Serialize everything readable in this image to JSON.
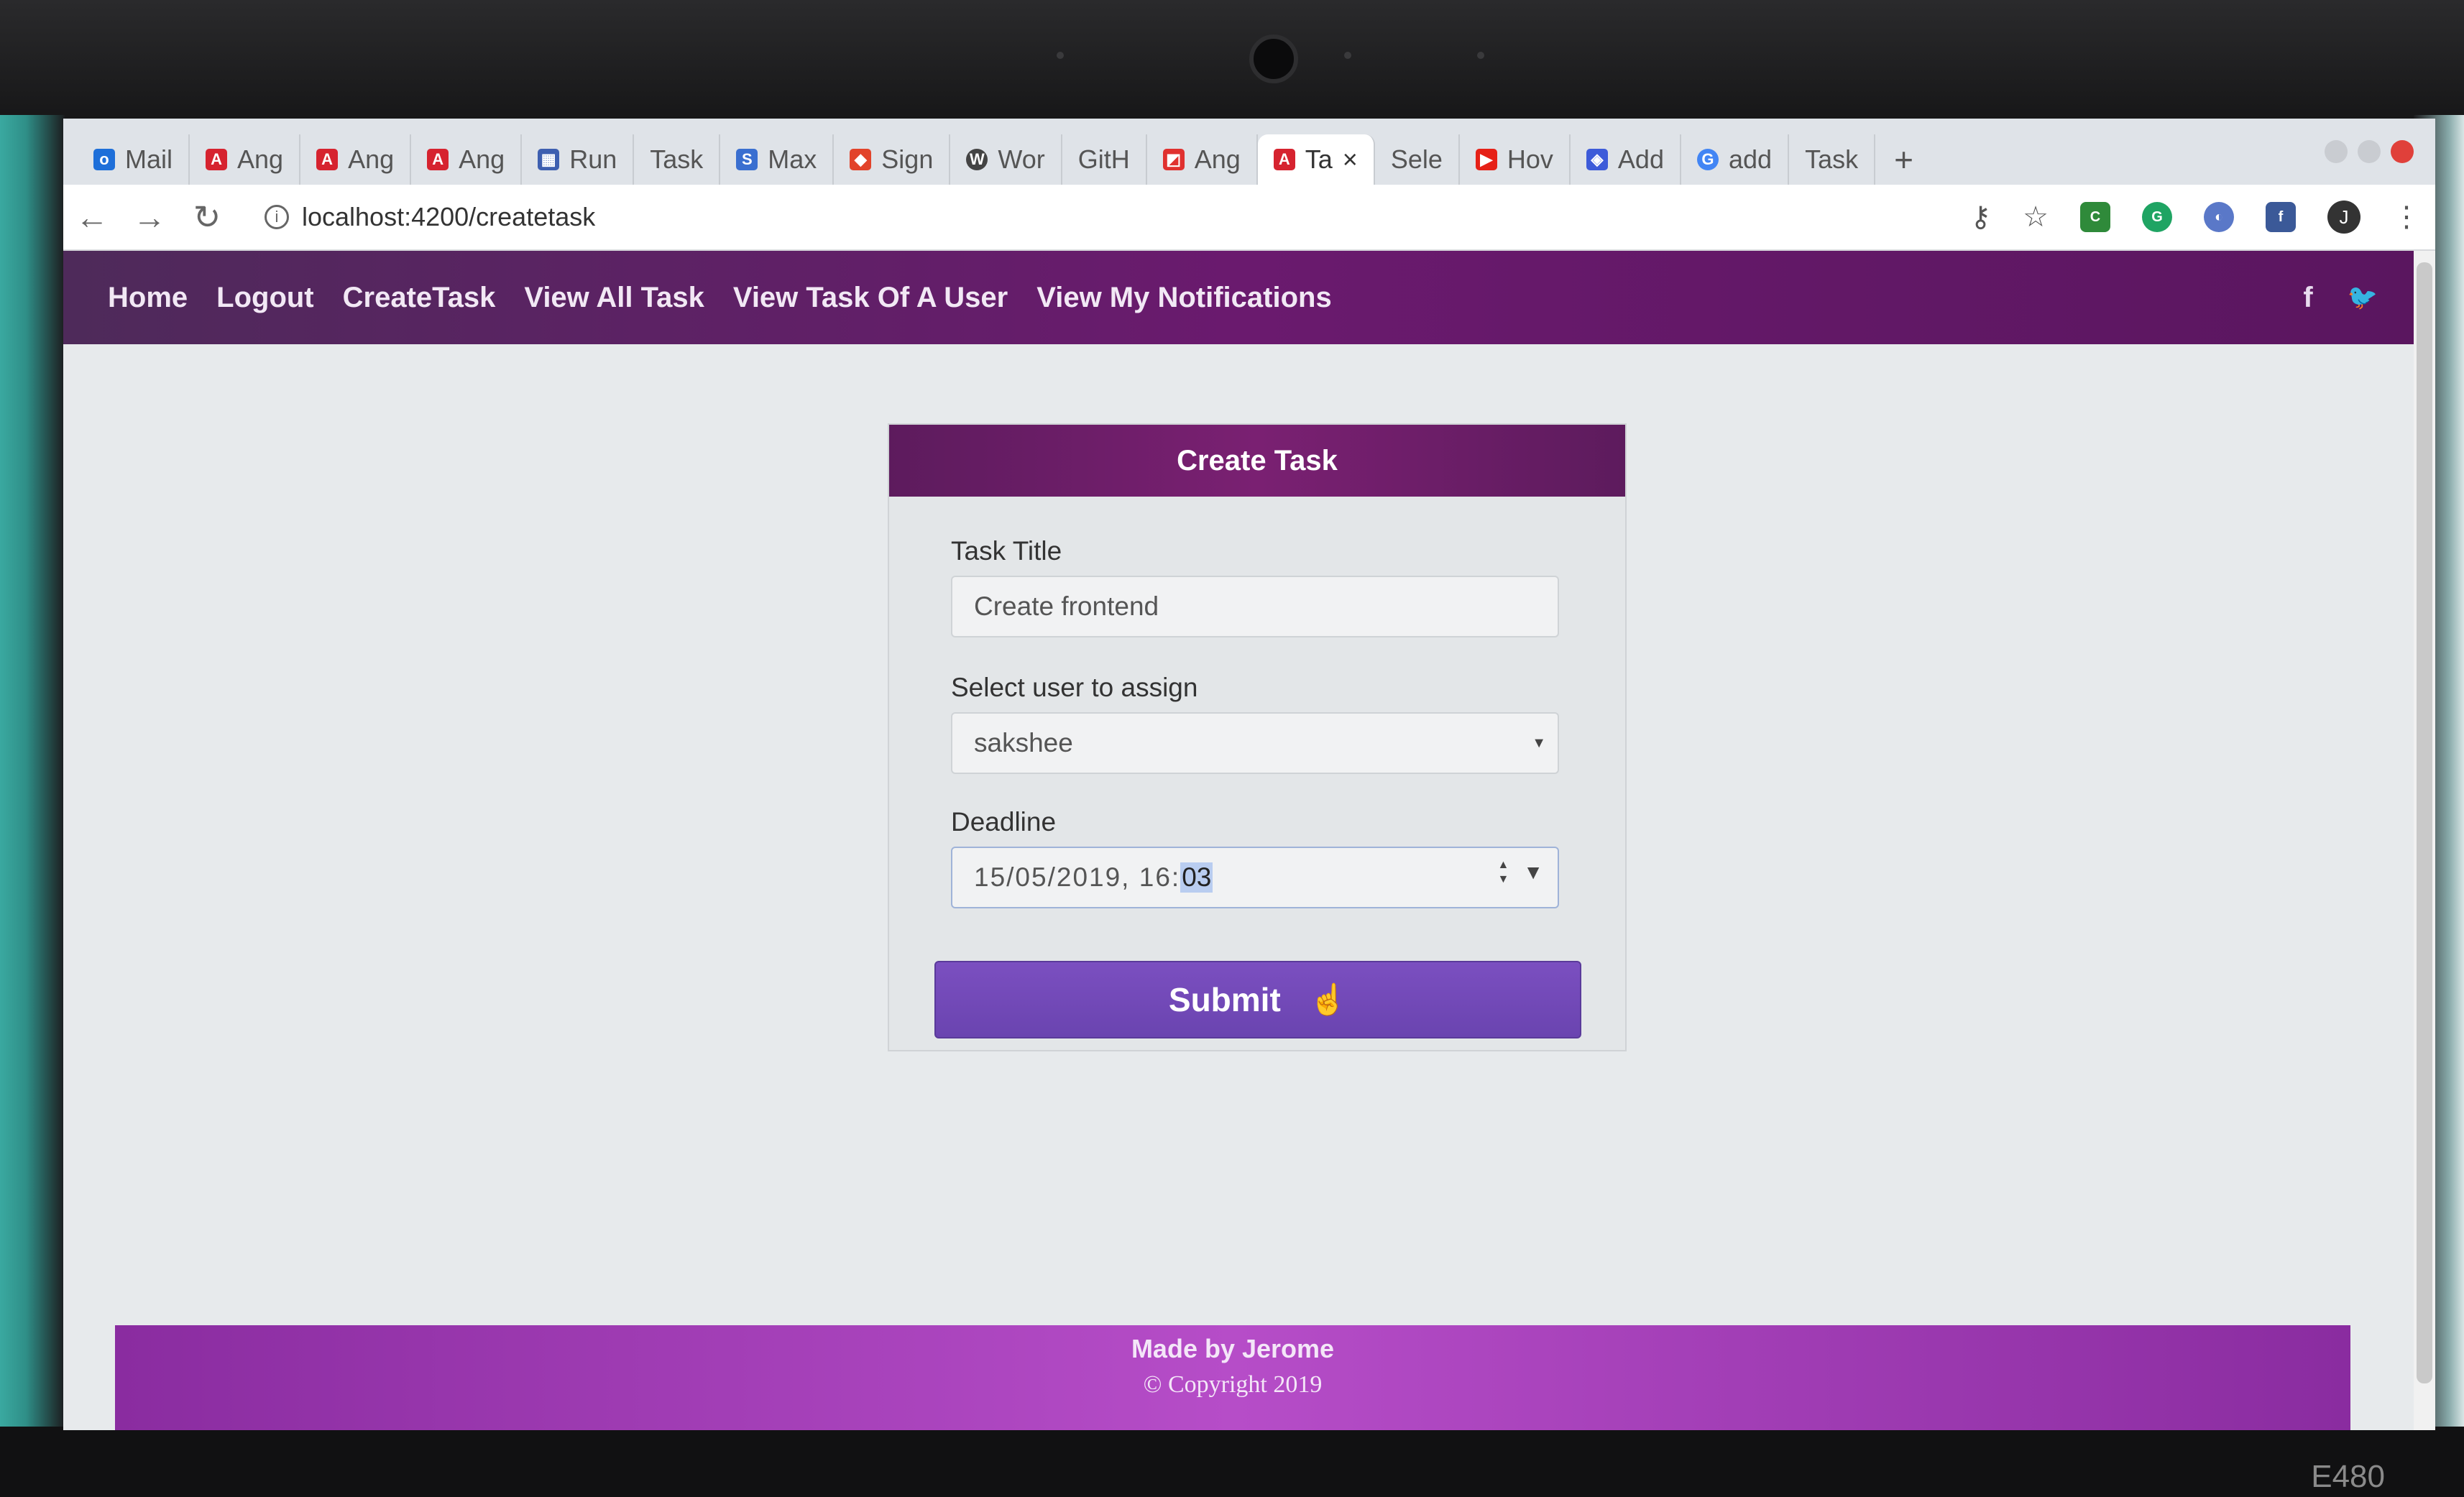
{
  "browser": {
    "tabs": [
      {
        "label": "Mail",
        "icon": "outlook-icon",
        "color": "#1e6fd9"
      },
      {
        "label": "Ang",
        "icon": "angular-icon",
        "color": "#d6232f"
      },
      {
        "label": "Ang",
        "icon": "angular-icon",
        "color": "#d6232f"
      },
      {
        "label": "Ang",
        "icon": "angular-icon",
        "color": "#d6232f"
      },
      {
        "label": "Run",
        "icon": "table-icon",
        "color": "#3e5fb0"
      },
      {
        "label": "Task",
        "icon": "",
        "color": ""
      },
      {
        "label": "Max",
        "icon": "skype-icon",
        "color": "#3a6fd0"
      },
      {
        "label": "Sign",
        "icon": "gitlab-icon",
        "color": "#e2432a"
      },
      {
        "label": "Wor",
        "icon": "wordpress-icon",
        "color": "#444444"
      },
      {
        "label": "GitH",
        "icon": "",
        "color": ""
      },
      {
        "label": "Ang",
        "icon": "bookmark-icon",
        "color": "#e0312f"
      },
      {
        "label": "Ta",
        "icon": "angular-icon",
        "color": "#d6232f",
        "active": true
      },
      {
        "label": "Sele",
        "icon": "",
        "color": ""
      },
      {
        "label": "Hov",
        "icon": "youtube-icon",
        "color": "#e62117"
      },
      {
        "label": "Add",
        "icon": "extension-icon",
        "color": "#3d5bd9"
      },
      {
        "label": "add",
        "icon": "google-icon",
        "color": "#4285f4"
      },
      {
        "label": "Task",
        "icon": "",
        "color": ""
      }
    ],
    "new_tab_label": "+",
    "close_tab_label": "×",
    "url": "localhost:4200/createtask"
  },
  "navbar": {
    "links": [
      "Home",
      "Logout",
      "CreateTask",
      "View All Task",
      "View Task Of A User",
      "View My Notifications"
    ],
    "social": {
      "facebook": "f",
      "twitter": "🐦"
    }
  },
  "form": {
    "header": "Create Task",
    "task_title_label": "Task Title",
    "task_title_value": "Create frontend",
    "assign_label": "Select user to assign",
    "assign_value": "sakshee",
    "deadline_label": "Deadline",
    "deadline_prefix": "15/05/2019, 16:",
    "deadline_selected": "03",
    "submit_label": "Submit"
  },
  "footer": {
    "made_by": "Made by Jerome",
    "copyright": "© Copyright 2019"
  },
  "device": {
    "model": "E480"
  },
  "colors": {
    "navbar": "#6a1a6e",
    "card_header": "#7a2072",
    "submit": "#6a44b0",
    "footer": "#b64dc8"
  }
}
